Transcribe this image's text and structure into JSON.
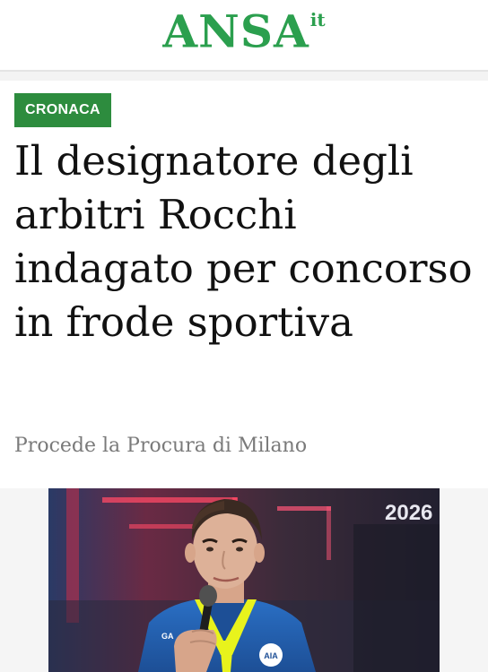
{
  "header": {
    "logo_text": "ANSA",
    "logo_suffix": "it",
    "brand_color": "#2b9f4e"
  },
  "article": {
    "category": "CRONACA",
    "category_color": "#2d8c3e",
    "headline": "Il designatore degli arbitri Rocchi indagato per concorso in frode sportiva",
    "subtitle": "Procede la Procura di Milano"
  },
  "photo": {
    "backdrop_text": "2026"
  }
}
